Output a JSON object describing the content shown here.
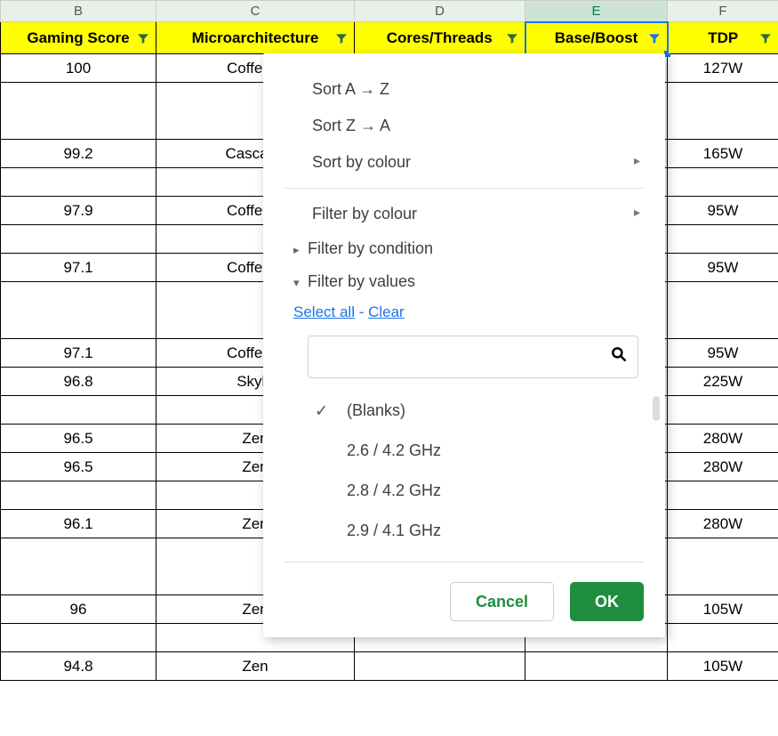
{
  "columns": {
    "B": "B",
    "C": "C",
    "D": "D",
    "E": "E",
    "F": "F"
  },
  "headers": {
    "B": "Gaming Score",
    "C": "Microarchitecture",
    "D": "Cores/Threads",
    "E": "Base/Boost",
    "F": "TDP"
  },
  "rows": [
    {
      "B": "100",
      "C": "Coffee L",
      "F": "127W"
    },
    {
      "B": "",
      "C": "",
      "F": ""
    },
    {
      "B": "99.2",
      "C": "Cascade",
      "F": "165W"
    },
    {
      "B": "",
      "C": "",
      "F": ""
    },
    {
      "B": "97.9",
      "C": "Coffee L",
      "F": "95W"
    },
    {
      "B": "",
      "C": "",
      "F": ""
    },
    {
      "B": "97.1",
      "C": "Coffee L",
      "F": "95W"
    },
    {
      "B": "",
      "C": "",
      "F": ""
    },
    {
      "B": "",
      "C": "",
      "F": ""
    },
    {
      "B": "97.1",
      "C": "Coffee L",
      "F": "95W"
    },
    {
      "B": "96.8",
      "C": "Skyla",
      "F": "225W"
    },
    {
      "B": "",
      "C": "",
      "F": ""
    },
    {
      "B": "96.5",
      "C": "Zen",
      "F": "280W"
    },
    {
      "B": "96.5",
      "C": "Zen",
      "F": "280W"
    },
    {
      "B": "",
      "C": "",
      "F": ""
    },
    {
      "B": "96.1",
      "C": "Zen",
      "F": "280W"
    },
    {
      "B": "",
      "C": "",
      "F": ""
    },
    {
      "B": "",
      "C": "",
      "F": ""
    },
    {
      "B": "96",
      "C": "Zen",
      "F": "105W"
    },
    {
      "B": "",
      "C": "",
      "F": ""
    },
    {
      "B": "94.8",
      "C": "Zen",
      "F": "105W"
    }
  ],
  "popup": {
    "sort_az": "Sort A → Z",
    "sort_za": "Sort Z → A",
    "sort_colour": "Sort by colour",
    "filter_colour": "Filter by colour",
    "filter_condition": "Filter by condition",
    "filter_values": "Filter by values",
    "select_all": "Select all",
    "dash": " - ",
    "clear": "Clear",
    "search_placeholder": "",
    "values": {
      "blanks": "(Blanks)",
      "v1": "2.6 / 4.2 GHz",
      "v2": "2.8 / 4.2 GHz",
      "v3": "2.9 / 4.1 GHz"
    },
    "cancel": "Cancel",
    "ok": "OK"
  }
}
